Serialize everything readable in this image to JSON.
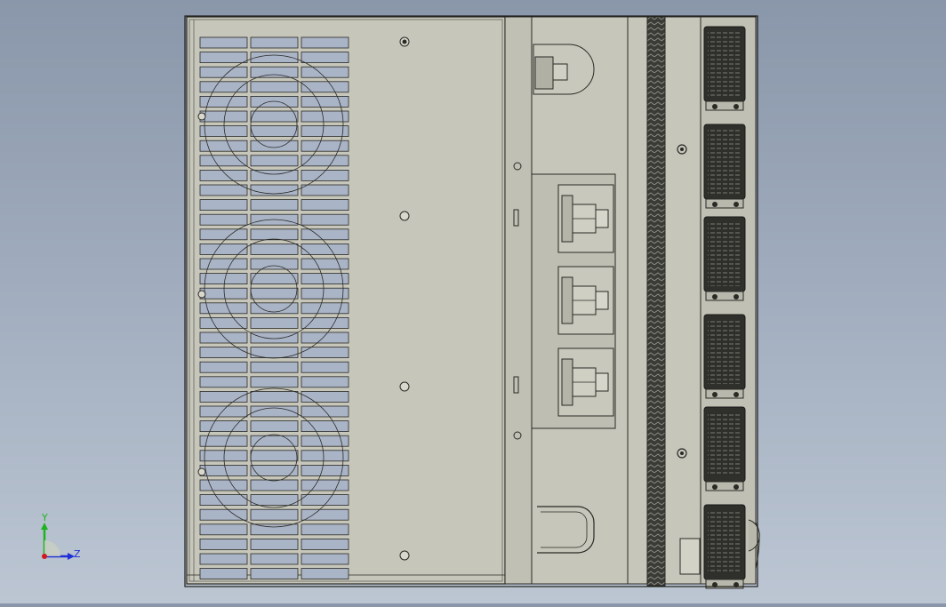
{
  "viewport": {
    "view": "cad-model-front-view"
  },
  "triad": {
    "y_label": "Y",
    "z_label": "Z",
    "colors": {
      "y": "#1db31d",
      "z": "#1f2fd6",
      "x": "#d11b1b"
    }
  },
  "colors": {
    "background_top": "#8a97aa",
    "background_bottom": "#bcc6d3",
    "body_fill": "#c4c4b8",
    "edge": "#2a2a26",
    "vent_fill": "#aab4c7",
    "connector_dark": "#2f2f2c"
  }
}
